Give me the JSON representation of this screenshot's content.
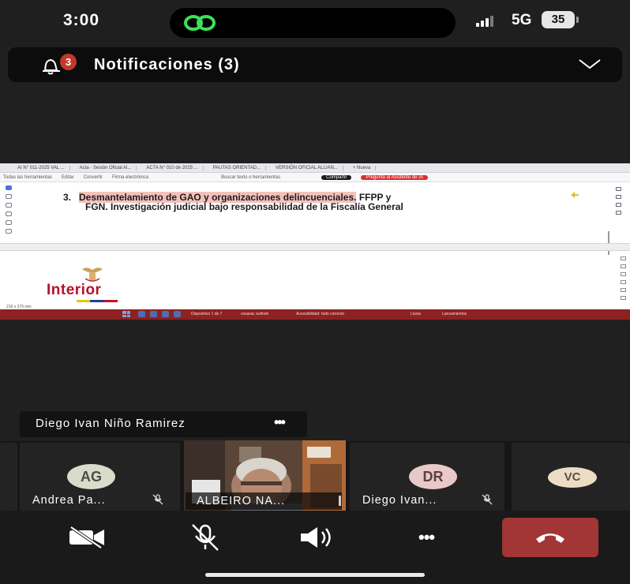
{
  "status_bar": {
    "time": "3:00",
    "network": "5G",
    "battery": "35"
  },
  "notification": {
    "badge_count": "3",
    "title": "Notificaciones (3)"
  },
  "shared_screen": {
    "browser_tabs": [
      "AI N° 011-2025 VAL ...",
      "Acta - Sesión Oficial Al...",
      "ACTA N° 010 de 2025 ...",
      "PAUTAS ORIENTAD...",
      "VERSIÓN OFICIAL ALLIAN...",
      "+ Nueva"
    ],
    "toolbar": {
      "tools": [
        "Todas las herramientas",
        "Editar",
        "Convertir",
        "Firma electrónica"
      ],
      "search": "Buscar texto o herramientas",
      "share": "Compartir",
      "assistant": "Pregunta al Asistente de IA"
    },
    "doc_item_number": "3.",
    "doc_item_title": "Desmantelamiento de GAO y organizaciones delincuenciales.",
    "doc_item_rest": "FFPP y",
    "doc_line2": "FGN.  Investigación judicial bajo responsabilidad de la Fiscalía General",
    "logo_text": "Interior",
    "page_size": "216 x 279 mm",
    "taskbar_items": [
      "Dispositivo 1 de 7",
      "cesarac outlook",
      "Accesibilidad: todo correcto",
      "Lluvia",
      "Lanzamientos"
    ],
    "flag_colors": [
      "#f2c200",
      "#1f3f9b",
      "#c8102e"
    ]
  },
  "active_speaker": {
    "name": "Diego Ivan Niño Ramirez",
    "more": "•••"
  },
  "participants": [
    {
      "initials": "AG",
      "label": "Andrea Pa...",
      "muted": true
    },
    {
      "label": "ALBEIRO NA...",
      "video": true
    },
    {
      "initials": "DR",
      "label": "Diego Ivan...",
      "muted": true
    },
    {
      "initials": "VC",
      "label": ""
    }
  ],
  "controls": {
    "camera": "camera-off",
    "mic": "mic-off",
    "speaker": "speaker-on",
    "more": "•••",
    "end_call": "hang-up"
  },
  "colors": {
    "end_call": "#a23535",
    "badge": "#c0392b",
    "logo": "#b7102b",
    "avatar_ag": "#d9dccb",
    "avatar_dr": "#e8c8c8",
    "avatar_vc": "#ecdcc4"
  }
}
